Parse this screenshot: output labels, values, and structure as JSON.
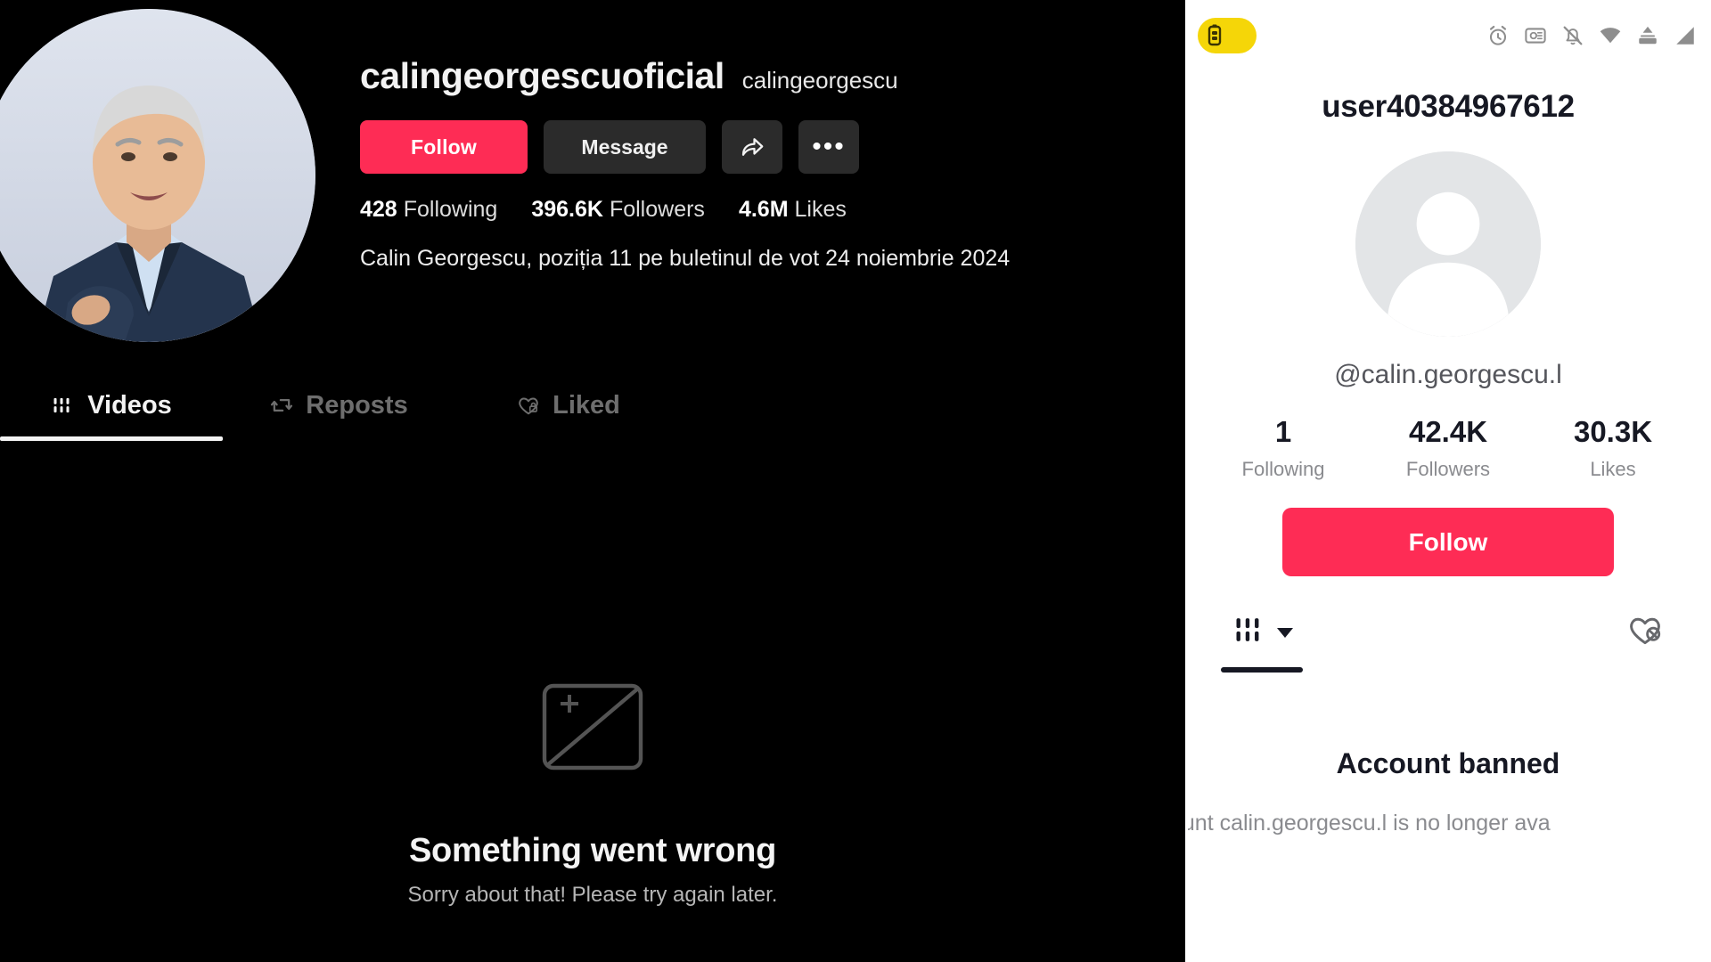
{
  "desktop": {
    "display_name": "calingeorgescuoficial",
    "handle": "calingeorgescu",
    "buttons": {
      "follow": "Follow",
      "message": "Message",
      "share_icon": "share-arrow-icon",
      "more_icon": "more-options-icon"
    },
    "stats": [
      {
        "value": "428",
        "label": "Following"
      },
      {
        "value": "396.6K",
        "label": "Followers"
      },
      {
        "value": "4.6M",
        "label": "Likes"
      }
    ],
    "bio": "Calin Georgescu, poziția 11 pe buletinul de vot 24 noiembrie 2024",
    "tabs": [
      {
        "label": "Videos",
        "icon": "grid-icon",
        "active": true
      },
      {
        "label": "Reposts",
        "icon": "repost-icon",
        "active": false
      },
      {
        "label": "Liked",
        "icon": "heart-lock-icon",
        "active": false
      }
    ],
    "error": {
      "icon": "broken-image-icon",
      "title": "Something went wrong",
      "subtitle": "Sorry about that! Please try again later."
    },
    "accent_color": "#fe2c55",
    "background_color": "#000000"
  },
  "mobile": {
    "status_bar": {
      "battery_badge_icon": "battery-saver-icon",
      "battery_badge_color": "#f5d608",
      "icons": [
        "alarm-clock-icon",
        "screen-capture-icon",
        "bell-muted-icon",
        "wifi-icon",
        "hotspot-icon",
        "signal-icon"
      ]
    },
    "username": "user40384967612",
    "avatar_icon": "default-avatar-icon",
    "handle": "@calin.georgescu.l",
    "stats": [
      {
        "value": "1",
        "label": "Following"
      },
      {
        "value": "42.4K",
        "label": "Followers"
      },
      {
        "value": "30.3K",
        "label": "Likes"
      }
    ],
    "follow_label": "Follow",
    "tabs": [
      {
        "icon": "grid-dropdown-icon",
        "active": true
      },
      {
        "icon": "heart-hidden-icon",
        "active": false
      }
    ],
    "banned": {
      "title": "Account banned",
      "subtitle": "ccount calin.georgescu.l is no longer ava"
    },
    "accent_color": "#fe2c55",
    "background_color": "#ffffff"
  }
}
